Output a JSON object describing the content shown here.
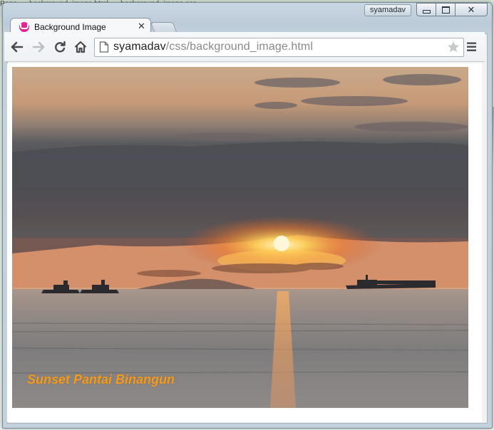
{
  "background_app": {
    "strip_items": [
      "Page",
      "background_image.html",
      "background_image.css"
    ]
  },
  "window": {
    "profile_name": "syamadav"
  },
  "tab": {
    "title": "Background Image",
    "close_glyph": "✕"
  },
  "toolbar": {
    "url_host": "syamadav",
    "url_path": "/css/background_image.html"
  },
  "page": {
    "caption": "Sunset Pantai Binangun"
  },
  "colors": {
    "caption": "#f49b1c",
    "favicon": "#e2249a"
  },
  "icons": [
    "back-arrow-icon",
    "forward-arrow-icon",
    "reload-icon",
    "home-icon",
    "page-icon",
    "star-icon",
    "menu-icon",
    "close-icon"
  ]
}
